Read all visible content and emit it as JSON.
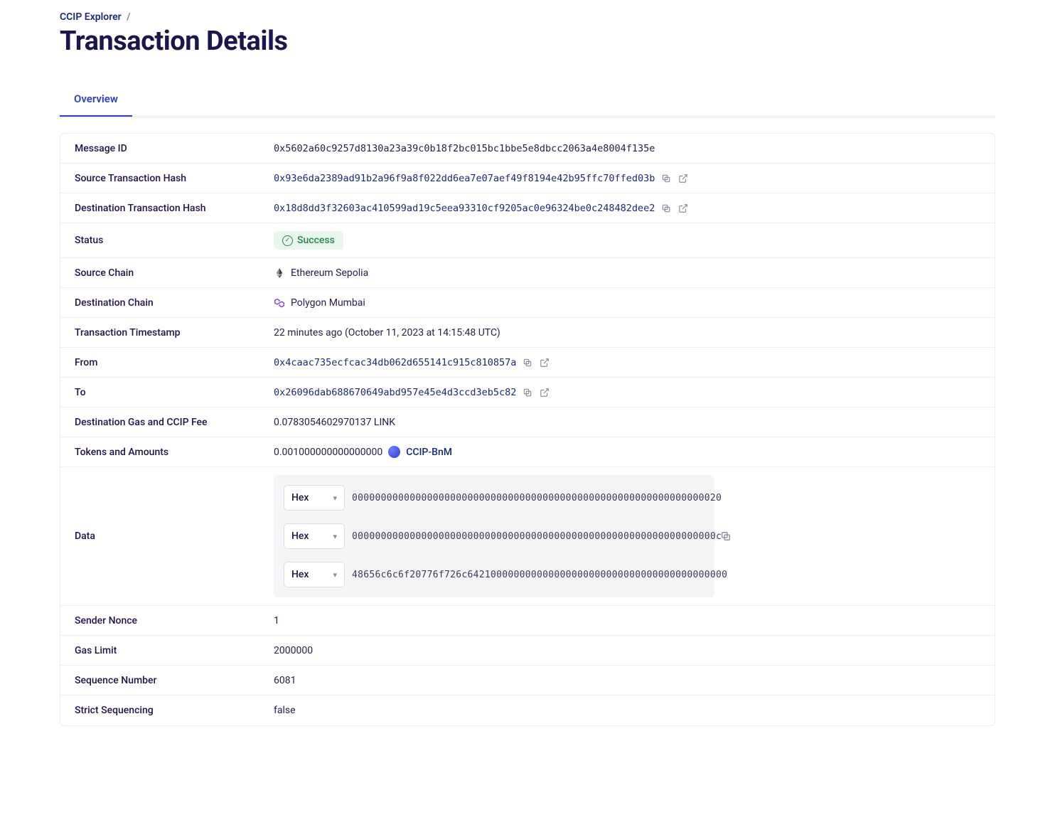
{
  "breadcrumb": {
    "root": "CCIP Explorer",
    "sep": "/"
  },
  "page_title": "Transaction Details",
  "tabs": {
    "overview": "Overview"
  },
  "labels": {
    "message_id": "Message ID",
    "source_tx": "Source Transaction Hash",
    "dest_tx": "Destination Transaction Hash",
    "status": "Status",
    "source_chain": "Source Chain",
    "dest_chain": "Destination Chain",
    "timestamp": "Transaction Timestamp",
    "from": "From",
    "to": "To",
    "gas_fee": "Destination Gas and CCIP Fee",
    "tokens": "Tokens and Amounts",
    "data": "Data",
    "nonce": "Sender Nonce",
    "gas_limit": "Gas Limit",
    "seq": "Sequence Number",
    "strict": "Strict Sequencing"
  },
  "values": {
    "message_id": "0x5602a60c9257d8130a23a39c0b18f2bc015bc1bbe5e8dbcc2063a4e8004f135e",
    "source_tx": "0x93e6da2389ad91b2a96f9a8f022dd6ea7e07aef49f8194e42b95ffc70ffed03b",
    "dest_tx": "0x18d8dd3f32603ac410599ad19c5eea93310cf9205ac0e96324be0c248482dee2",
    "status": "Success",
    "source_chain": "Ethereum Sepolia",
    "dest_chain": "Polygon Mumbai",
    "timestamp": "22 minutes ago (October 11, 2023 at 14:15:48 UTC)",
    "from": "0x4caac735ecfcac34db062d655141c915c810857a",
    "to": "0x26096dab688670649abd957e45e4d3ccd3eb5c82",
    "gas_fee": "0.0783054602970137 LINK",
    "token_amount": "0.001000000000000000",
    "token_name": "CCIP-BnM",
    "hex_label": "Hex",
    "data_lines": [
      "0000000000000000000000000000000000000000000000000000000000000020",
      "000000000000000000000000000000000000000000000000000000000000000c",
      "48656c6c6f20776f726c642100000000000000000000000000000000000000000"
    ],
    "nonce": "1",
    "gas_limit": "2000000",
    "seq": "6081",
    "strict": "false"
  }
}
